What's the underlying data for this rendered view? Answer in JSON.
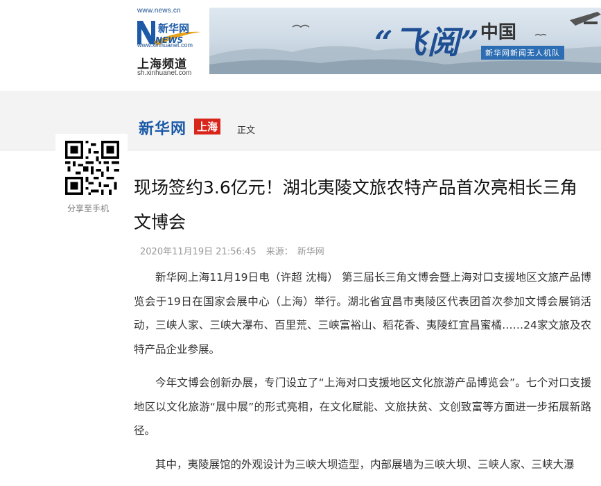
{
  "header": {
    "logo_url": "www.news.cn",
    "logo_brand": "新华网",
    "logo_news": "NEWS",
    "logo_url2": "www.xinhuanet.com",
    "channel_name": "上海频道",
    "channel_url": "sh.xinhuanet.com"
  },
  "banner": {
    "title_main": "“飞阅”",
    "title_suffix": "中国",
    "subtitle": "新华网新闻无人机队"
  },
  "nav": {
    "brand": "新华网",
    "region_tag": "上海",
    "crumb": "正文"
  },
  "share": {
    "label": "分享至手机"
  },
  "article": {
    "title": "现场签约3.6亿元！湖北夷陵文旅农特产品首次亮相长三角文博会",
    "datetime": "2020年11月19日 21:56:45",
    "source_label": "来源：",
    "source": "新华网",
    "paragraphs": [
      "新华网上海11月19日电（许超 沈梅） 第三届长三角文博会暨上海对口支援地区文旅产品博览会于19日在国家会展中心（上海）举行。湖北省宜昌市夷陵区代表团首次参加文博会展销活动，三峡人家、三峡大瀑布、百里荒、三峡富裕山、稻花香、夷陵红宜昌蜜橘……24家文旅及农特产品企业参展。",
      "今年文博会创新办展，专门设立了“上海对口支援地区文化旅游产品博览会”。七个对口支援地区以文化旅游“展中展”的形式亮相，在文化赋能、文旅扶贫、文创致富等方面进一步拓展新路径。",
      "其中，夷陵展馆的外观设计为三峡大坝造型，内部展墙为三峡大坝、三峡人家、三峡大瀑"
    ]
  },
  "colors": {
    "brand_blue": "#1c5aa8",
    "tag_red": "#d9261c",
    "nav_bg": "#f3f3f3"
  }
}
